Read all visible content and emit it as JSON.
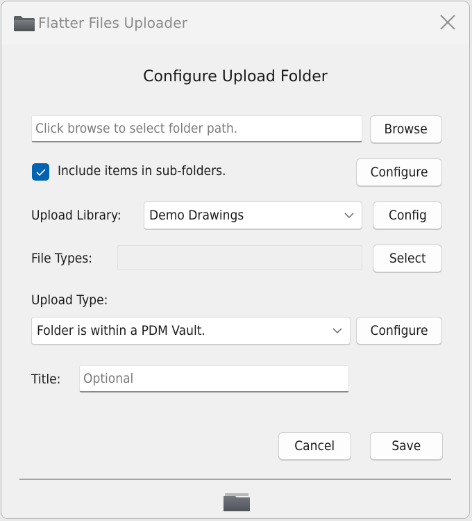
{
  "window": {
    "title": "Flatter Files Uploader",
    "title_icon": "folder-icon",
    "close_icon": "close-icon"
  },
  "dialog": {
    "heading": "Configure Upload Folder",
    "folder_path": {
      "value": "",
      "placeholder": "Click browse to select folder path.",
      "browse_label": "Browse"
    },
    "subfolders": {
      "checked": true,
      "label": "Include items in sub-folders.",
      "configure_label": "Configure"
    },
    "upload_library": {
      "label": "Upload Library:",
      "selected": "Demo Drawings",
      "config_label": "Config"
    },
    "file_types": {
      "label": "File Types:",
      "value": "",
      "select_label": "Select"
    },
    "upload_type": {
      "label": "Upload Type:",
      "selected": "Folder is within a PDM Vault.",
      "configure_label": "Configure"
    },
    "title_field": {
      "label": "Title:",
      "value": "",
      "placeholder": "Optional"
    },
    "cancel_label": "Cancel",
    "save_label": "Save",
    "footer_icon": "folder-icon"
  },
  "colors": {
    "accent": "#0063b1",
    "background": "#f0f0f0"
  }
}
